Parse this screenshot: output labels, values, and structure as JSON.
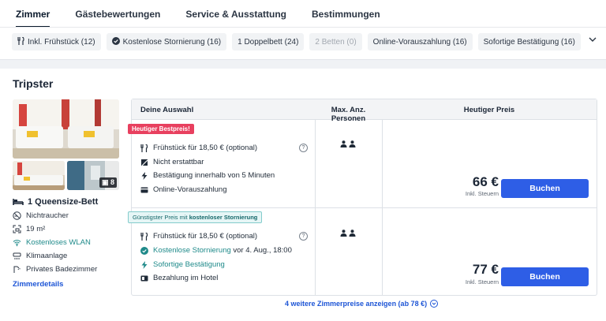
{
  "tabs": [
    {
      "label": "Zimmer",
      "active": true
    },
    {
      "label": "Gästebewertungen",
      "active": false
    },
    {
      "label": "Service & Ausstattung",
      "active": false
    },
    {
      "label": "Bestimmungen",
      "active": false
    }
  ],
  "filters": [
    {
      "label": "Inkl. Frühstück (12)",
      "icon": "breakfast-icon",
      "enabled": true
    },
    {
      "label": "Kostenlose Stornierung (16)",
      "icon": "check-circle-icon",
      "enabled": true
    },
    {
      "label": "1 Doppelbett (24)",
      "icon": "",
      "enabled": true
    },
    {
      "label": "2 Betten (0)",
      "icon": "",
      "enabled": false
    },
    {
      "label": "Online-Vorauszahlung (16)",
      "icon": "",
      "enabled": true
    },
    {
      "label": "Sofortige Bestätigung (16)",
      "icon": "",
      "enabled": true
    }
  ],
  "room": {
    "title": "Tripster",
    "photo_count": "8",
    "bed": "1 Queensize-Bett",
    "amenities": [
      {
        "label": "Nichtraucher",
        "icon": "no-smoking-icon",
        "highlight": false
      },
      {
        "label": "19 m²",
        "icon": "room-size-icon",
        "highlight": false
      },
      {
        "label": "Kostenloses WLAN",
        "icon": "wifi-icon",
        "highlight": true
      },
      {
        "label": "Klimaanlage",
        "icon": "air-conditioning-icon",
        "highlight": false
      },
      {
        "label": "Privates Badezimmer",
        "icon": "shower-icon",
        "highlight": false
      }
    ],
    "details_link": "Zimmerdetails"
  },
  "table": {
    "headers": {
      "choice": "Deine Auswahl",
      "persons": "Max. Anz. Personen",
      "price": "Heutiger Preis"
    },
    "offers": [
      {
        "badge": "Heutiger Bestpreis!",
        "features": [
          {
            "label": "Frühstück für 18,50 € (optional)",
            "icon": "breakfast-icon"
          },
          {
            "label": "Nicht erstattbar",
            "icon": "non-refundable-icon"
          },
          {
            "label": "Bestätigung innerhalb von 5 Minuten",
            "icon": "lightning-icon"
          },
          {
            "label": "Online-Vorauszahlung",
            "icon": "credit-card-icon"
          }
        ],
        "price": "66 €",
        "tax_note": "Inkl. Steuern",
        "button": "Buchen"
      },
      {
        "badge_prefix": "Günstigster Preis mit ",
        "badge_bold": "kostenloser Stornierung",
        "features": [
          {
            "label": "Frühstück für 18,50 € (optional)",
            "icon": "breakfast-icon"
          },
          {
            "label_teal": "Kostenlose Stornierung",
            "label_rest": " vor 4. Aug., 18:00",
            "icon": "check-circle-icon"
          },
          {
            "label": "Sofortige Bestätigung",
            "icon": "lightning-icon",
            "highlight": true
          },
          {
            "label": "Bezahlung im Hotel",
            "icon": "hotel-payment-icon"
          }
        ],
        "price": "77 €",
        "tax_note": "Inkl. Steuern",
        "button": "Buchen"
      }
    ]
  },
  "more_link": "4 weitere Zimmerpreise anzeigen (ab 78 €)",
  "colors": {
    "accent_blue": "#2e5ee6",
    "link_blue": "#1d55d6",
    "badge_pink": "#e8405f",
    "teal": "#1f8a8a"
  }
}
